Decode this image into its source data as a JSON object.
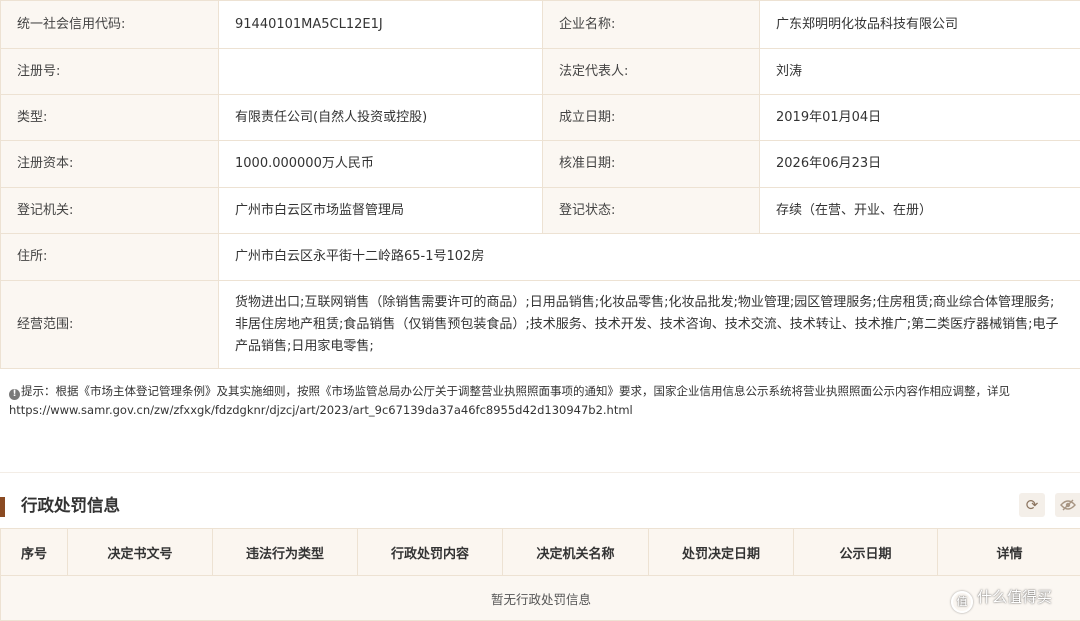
{
  "info": {
    "credit_code_label": "统一社会信用代码:",
    "credit_code": "91440101MA5CL12E1J",
    "company_name_label": "企业名称:",
    "company_name": "广东郑明明化妆品科技有限公司",
    "reg_no_label": "注册号:",
    "reg_no": "",
    "legal_rep_label": "法定代表人:",
    "legal_rep": "刘涛",
    "type_label": "类型:",
    "type": "有限责任公司(自然人投资或控股)",
    "founded_label": "成立日期:",
    "founded": "2019年01月04日",
    "capital_label": "注册资本:",
    "capital": "1000.000000万人民币",
    "approval_label": "核准日期:",
    "approval_date": "2026年06月23日",
    "authority_label": "登记机关:",
    "authority": "广州市白云区市场监督管理局",
    "status_label": "登记状态:",
    "status": "存续（在营、开业、在册）",
    "address_label": "住所:",
    "address": "广州市白云区永平街十二岭路65-1号102房",
    "scope_label": "经营范围:",
    "scope": "货物进出口;互联网销售（除销售需要许可的商品）;日用品销售;化妆品零售;化妆品批发;物业管理;园区管理服务;住房租赁;商业综合体管理服务;非居住房地产租赁;食品销售（仅销售预包装食品）;技术服务、技术开发、技术咨询、技术交流、技术转让、技术推广;第二类医疗器械销售;电子产品销售;日用家电零售;"
  },
  "notice": {
    "icon": "info-icon",
    "text": "提示：根据《市场主体登记管理条例》及其实施细则，按照《市场监管总局办公厅关于调整营业执照照面事项的通知》要求，国家企业信用信息公示系统将营业执照照面公示内容作相应调整，详见",
    "link": "https://www.samr.gov.cn/zw/zfxxgk/fdzdgknr/djzcj/art/2023/art_9c67139da37a46fc8955d42d130947b2.html"
  },
  "penalty": {
    "title": "行政处罚信息",
    "columns": [
      "序号",
      "决定书文号",
      "违法行为类型",
      "行政处罚内容",
      "决定机关名称",
      "处罚决定日期",
      "公示日期",
      "详情"
    ],
    "empty_text": "暂无行政处罚信息",
    "refresh_icon": "refresh-icon",
    "eye_icon": "eye-icon"
  },
  "watermark": {
    "logo_glyph": "值",
    "text": "什么值得买"
  },
  "colors": {
    "label_bg": "#fbf7f2",
    "border": "#ede2d3",
    "accent_bar": "#8a4a22"
  }
}
